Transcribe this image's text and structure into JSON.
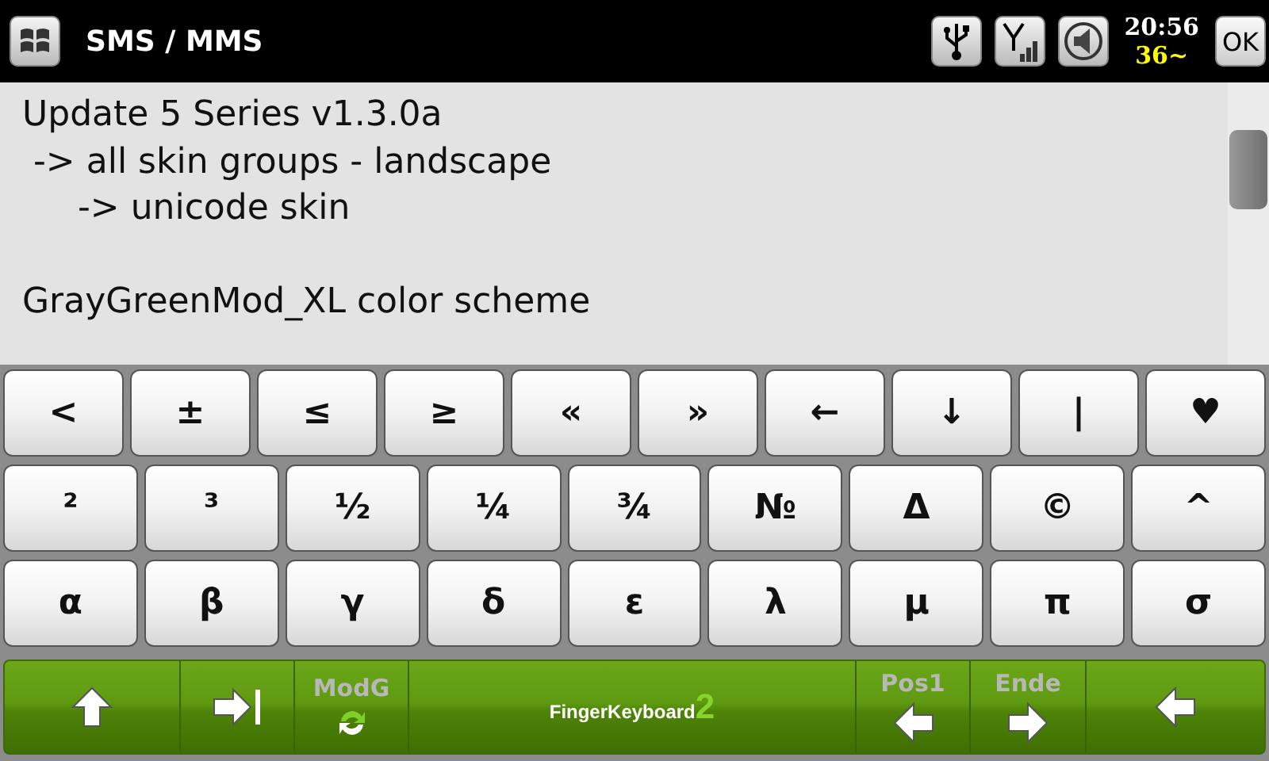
{
  "title_bar": {
    "title": "SMS / MMS",
    "time": "20:56",
    "temperature": "36~",
    "ok_button": "OK"
  },
  "message": {
    "text": "Update 5 Series v1.3.0a\n -> all skin groups - landscape\n     -> unicode skin\n\nGrayGreenMod_XL color scheme"
  },
  "keyboard": {
    "rows": [
      [
        "<",
        "±",
        "≤",
        "≥",
        "«",
        "»",
        "←",
        "↓",
        "|",
        "♥"
      ],
      [
        "²",
        "³",
        "½",
        "¼",
        "¾",
        "№",
        "Δ",
        "©",
        "^"
      ],
      [
        "α",
        "β",
        "γ",
        "δ",
        "ε",
        "λ",
        "μ",
        "π",
        "σ"
      ]
    ],
    "bottom_bar": [
      {
        "kind": "shift"
      },
      {
        "kind": "tab"
      },
      {
        "kind": "mode",
        "label": "ModG"
      },
      {
        "kind": "logo",
        "label": "FingerKeyboard",
        "suffix": "2"
      },
      {
        "kind": "home",
        "label": "Pos1"
      },
      {
        "kind": "end",
        "label": "Ende"
      },
      {
        "kind": "backspace"
      }
    ]
  }
}
